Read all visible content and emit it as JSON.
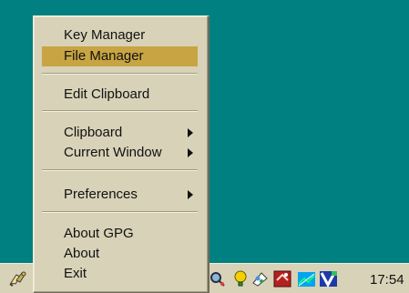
{
  "desktop": {
    "background_color": "#008080"
  },
  "context_menu": {
    "items": [
      {
        "label": "Key Manager",
        "selected": false,
        "has_submenu": false
      },
      {
        "label": "File Manager",
        "selected": true,
        "has_submenu": false
      },
      {
        "label": "Edit Clipboard",
        "selected": false,
        "has_submenu": false
      },
      {
        "label": "Clipboard",
        "selected": false,
        "has_submenu": true
      },
      {
        "label": "Current Window",
        "selected": false,
        "has_submenu": true
      },
      {
        "label": "Preferences",
        "selected": false,
        "has_submenu": true
      },
      {
        "label": "About GPG",
        "selected": false,
        "has_submenu": false
      },
      {
        "label": "About",
        "selected": false,
        "has_submenu": false
      },
      {
        "label": "Exit",
        "selected": false,
        "has_submenu": false
      }
    ],
    "menu_color": "#d8d2b8",
    "selection_color": "#c8a442"
  },
  "taskbar": {
    "color": "#d8d2b8",
    "clock": "17:54",
    "tray_icons": [
      "search-tray-icon",
      "lightbulb-tray-icon",
      "paint-tray-icon",
      "red-app-tray-icon",
      "signal-tray-icon",
      "volume-tray-icon"
    ],
    "left_tray_icon": "gpg-key-icon"
  }
}
